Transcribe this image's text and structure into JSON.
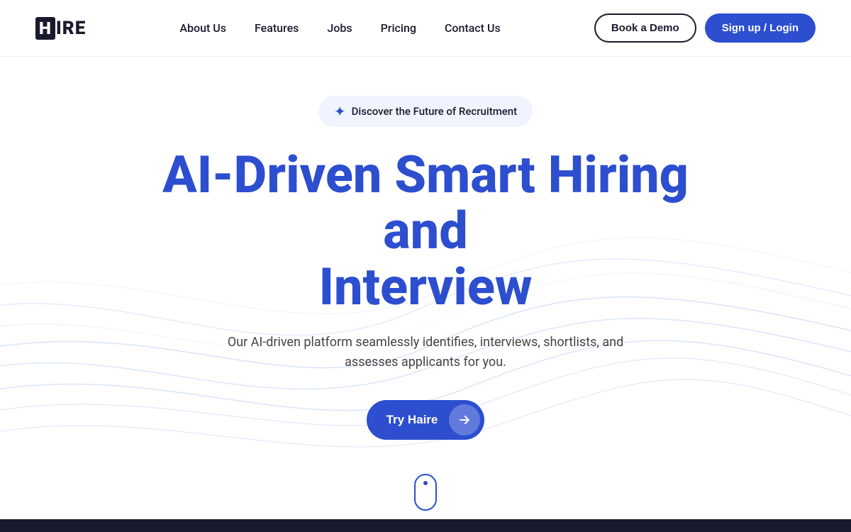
{
  "navbar": {
    "logo_h": "H",
    "logo_ire": "IRE",
    "links": [
      {
        "id": "about",
        "label": "About Us"
      },
      {
        "id": "features",
        "label": "Features"
      },
      {
        "id": "jobs",
        "label": "Jobs"
      },
      {
        "id": "pricing",
        "label": "Pricing"
      },
      {
        "id": "contact",
        "label": "Contact Us"
      }
    ],
    "book_demo_label": "Book a Demo",
    "signup_label": "Sign up / Login"
  },
  "hero": {
    "badge_text": "Discover the Future of Recruitment",
    "title_line1": "AI-Driven Smart Hiring and",
    "title_line2": "Interview",
    "subtitle": "Our AI-driven platform seamlessly identifies, interviews, shortlists, and assesses applicants for you.",
    "cta_label": "Try Haire"
  }
}
